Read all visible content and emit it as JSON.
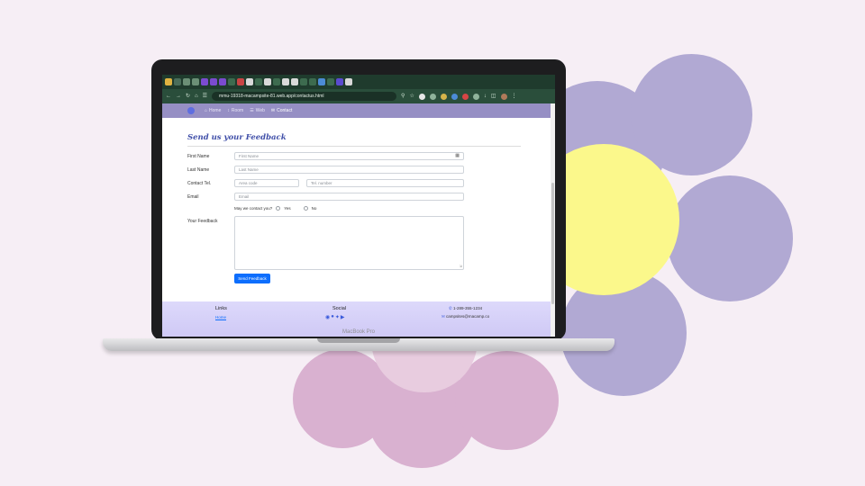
{
  "browser": {
    "url": "mmu-19318-macampsite-81.web.app/contactus.html"
  },
  "nav": {
    "items": [
      {
        "label": "Home",
        "icon": "home-icon",
        "active": false
      },
      {
        "label": "Room",
        "icon": "pin-icon",
        "active": false
      },
      {
        "label": "Web",
        "icon": "menu-icon",
        "active": false
      },
      {
        "label": "Contact",
        "icon": "envelope-icon",
        "active": true
      }
    ]
  },
  "form": {
    "title": "Send us your Feedback",
    "first_name_label": "First Name",
    "first_name_placeholder": "First Name",
    "last_name_label": "Last Name",
    "last_name_placeholder": "Last Name",
    "contact_label": "Contact Tel.",
    "area_code_placeholder": "Area code",
    "tel_placeholder": "Tel. number",
    "email_label": "Email",
    "email_placeholder": "Email",
    "contact_question": "May we contact you?",
    "yes_label": "Yes",
    "no_label": "No",
    "feedback_label": "Your Feedback",
    "submit_label": "Send Feedback"
  },
  "footer": {
    "links_heading": "Links",
    "links_first": "Home",
    "social_heading": "Social",
    "phone": "1-289-355-1234",
    "email": "campsites@macamp.co"
  },
  "laptop": {
    "brand": "MacBook Pro"
  },
  "colors": {
    "navbar": "#968fc4",
    "title": "#3f4ea8",
    "button": "#0d6efd",
    "footer": "#d8d4fa",
    "flower_purple": "#b1a9d3",
    "flower_pink": "#d9b1d0",
    "flower_center": "#fbf88b"
  }
}
